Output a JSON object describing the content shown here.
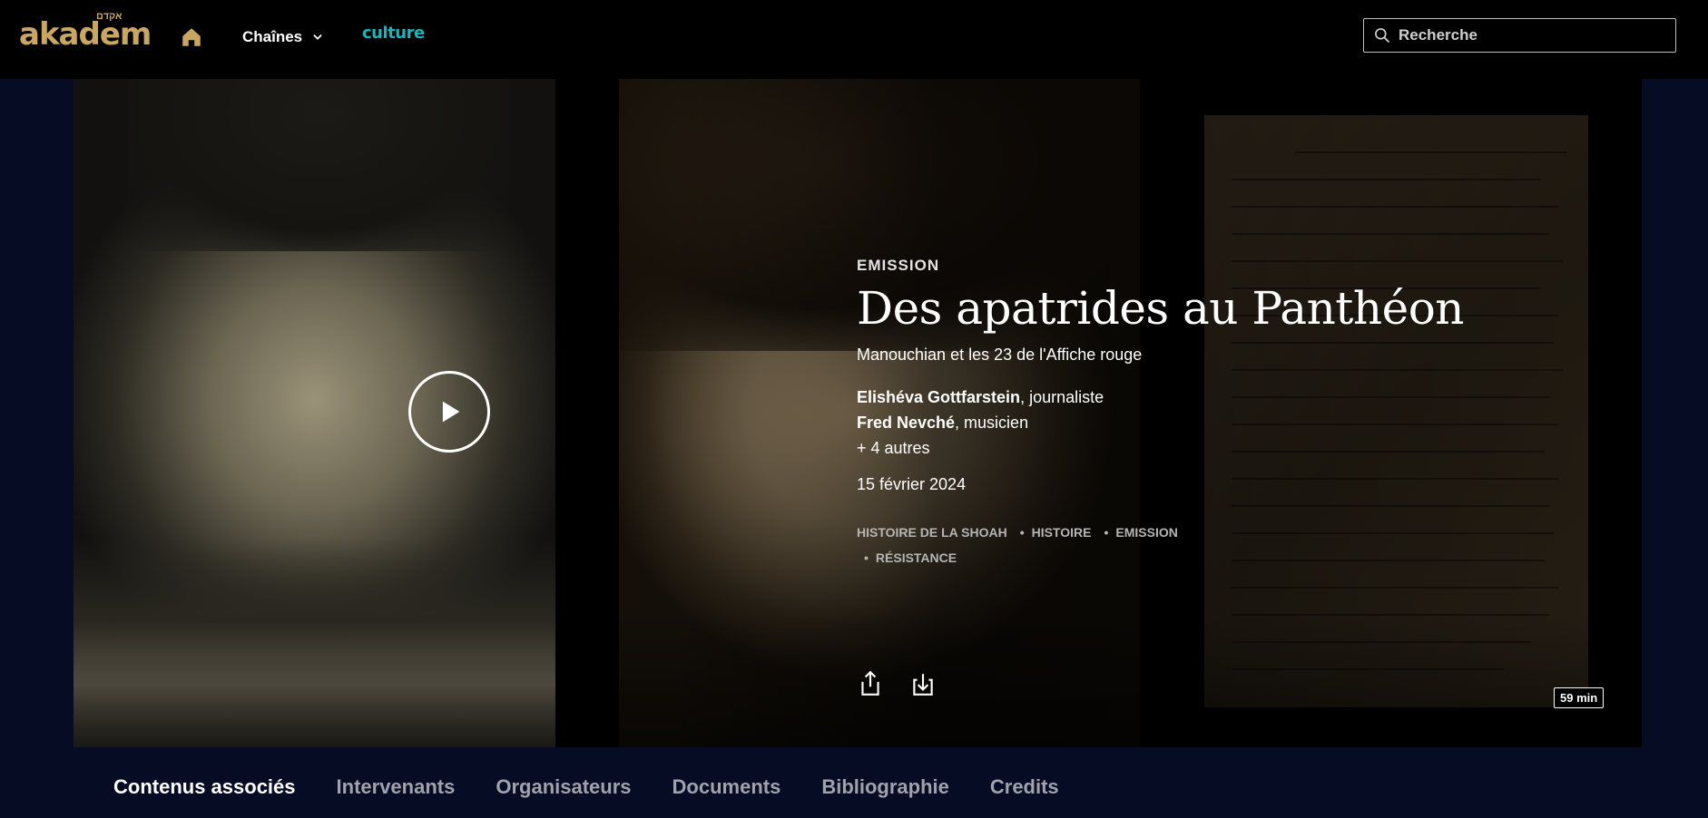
{
  "header": {
    "logo_text": "akadem",
    "logo_hebrew": "אקדם",
    "channels_label": "Chaînes",
    "culture_label": "culture",
    "search_placeholder": "Recherche"
  },
  "hero": {
    "category": "EMISSION",
    "title": "Des apatrides au Panthéon",
    "subtitle": "Manouchian et les 23 de l'Affiche rouge",
    "speakers": [
      {
        "name": "Elishéva Gottfarstein",
        "role": ", journaliste"
      },
      {
        "name": "Fred Nevché",
        "role": ", musicien"
      }
    ],
    "more_speakers": "+ 4 autres",
    "date": "15 février 2024",
    "tags": [
      "HISTOIRE DE LA SHOAH",
      "HISTOIRE",
      "EMISSION",
      "RÉSISTANCE"
    ],
    "duration": "59 min"
  },
  "tabs": [
    {
      "label": "Contenus associés",
      "active": true
    },
    {
      "label": "Intervenants",
      "active": false
    },
    {
      "label": "Organisateurs",
      "active": false
    },
    {
      "label": "Documents",
      "active": false
    },
    {
      "label": "Bibliographie",
      "active": false
    },
    {
      "label": "Credits",
      "active": false
    }
  ],
  "colors": {
    "brand_gold": "#c9a763",
    "culture_teal": "#18b6b8",
    "page_bg": "#050c23"
  }
}
